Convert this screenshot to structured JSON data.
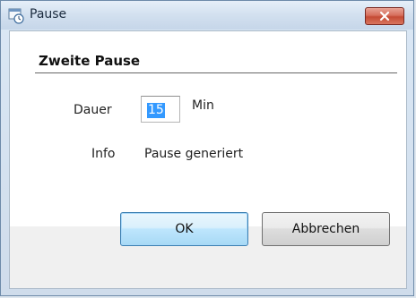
{
  "window": {
    "title": "Pause",
    "icon": "clock-window-icon",
    "close_icon": "close-icon"
  },
  "section": {
    "title": "Zweite Pause"
  },
  "fields": {
    "dauer_label": "Dauer",
    "dauer_value": "15",
    "dauer_unit": "Min",
    "info_label": "Info",
    "info_value": "Pause generiert"
  },
  "buttons": {
    "ok_label": "OK",
    "cancel_label": "Abbrechen"
  },
  "colors": {
    "selection": "#3399ff",
    "close_button": "#c44b35"
  }
}
